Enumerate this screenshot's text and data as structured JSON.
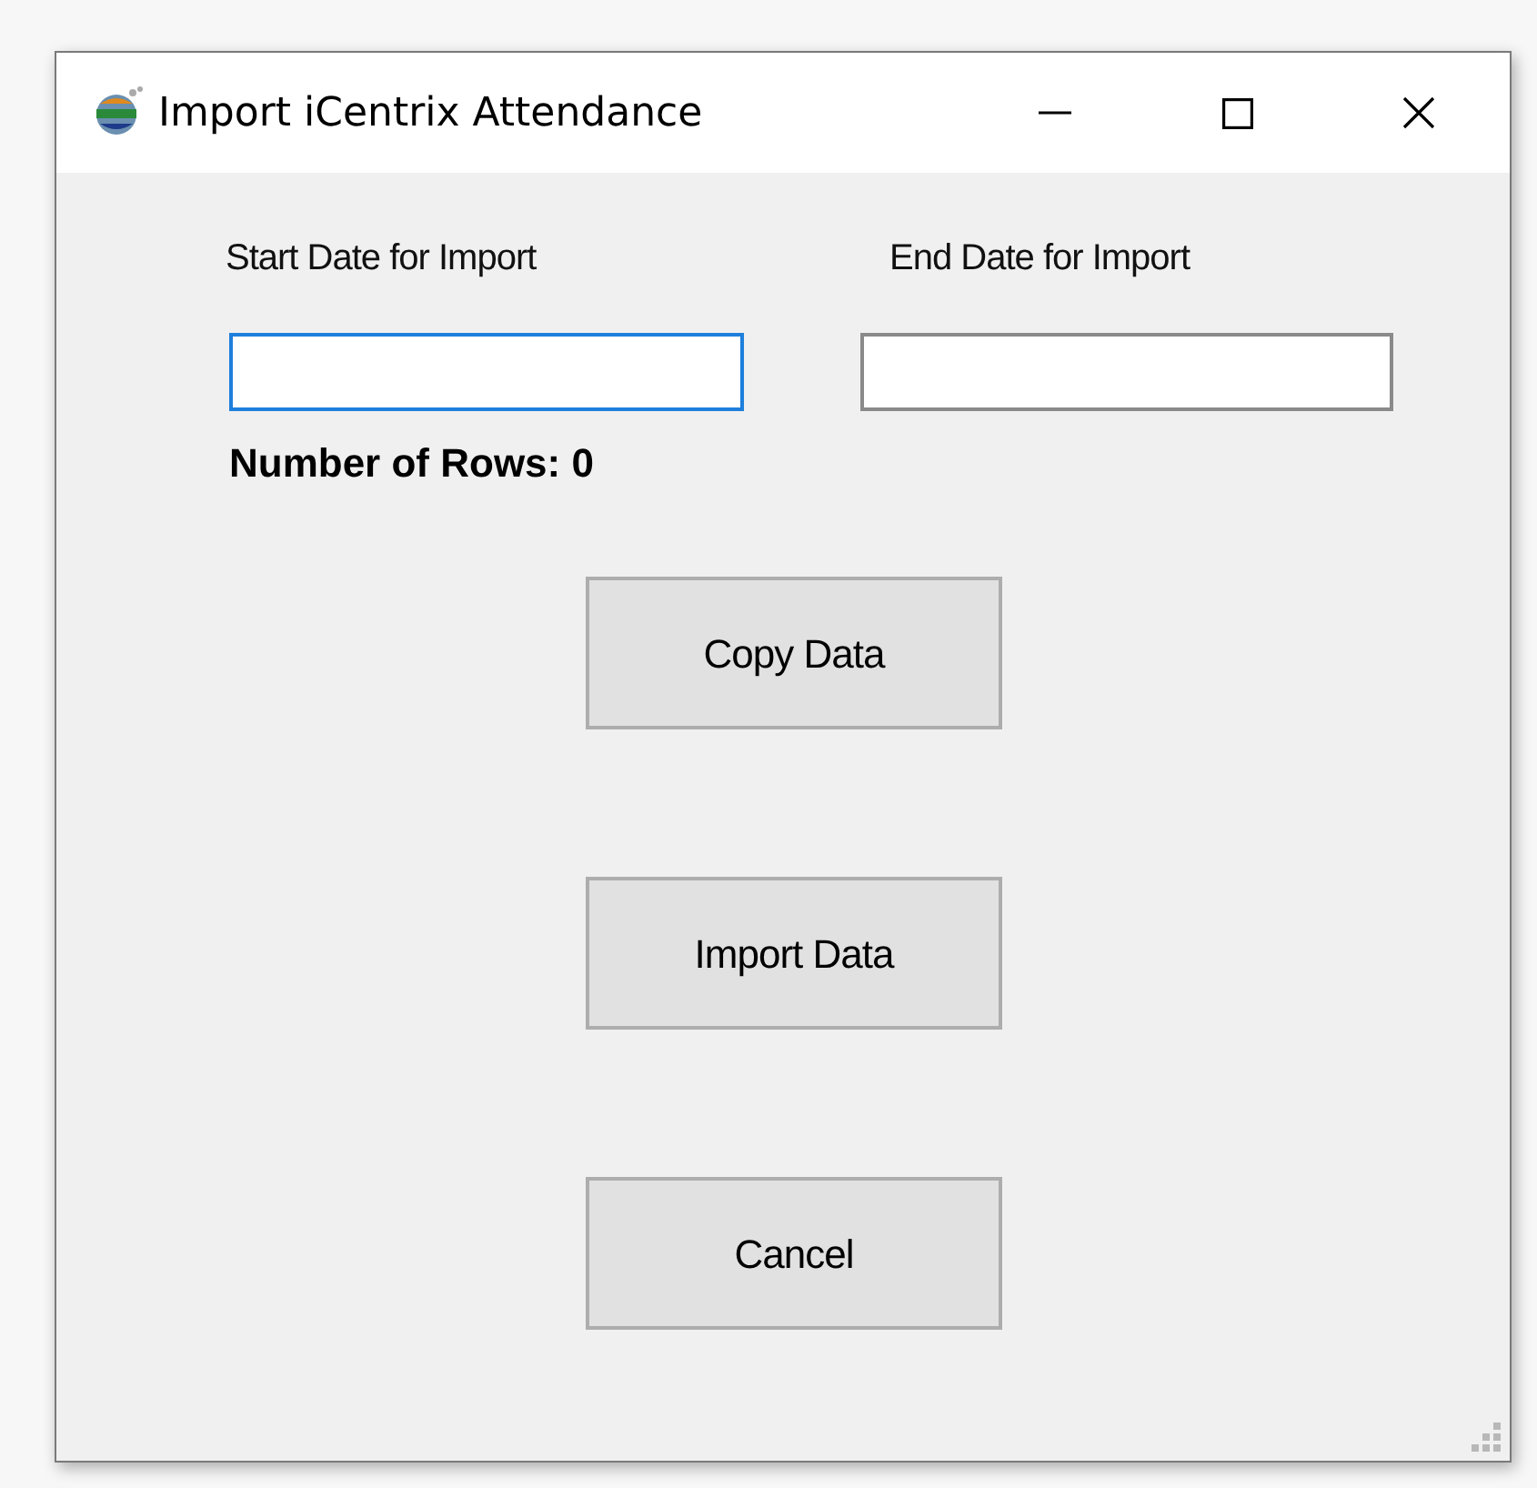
{
  "window": {
    "title": "Import iCentrix Attendance"
  },
  "fields": [
    {
      "label": "Start Date for Import",
      "focused": true
    },
    {
      "label": "End Date for Import",
      "focused": false
    }
  ],
  "row_count": "Number of Rows: 0",
  "buttons": [
    "Copy Data",
    "Import Data",
    "Cancel"
  ]
}
